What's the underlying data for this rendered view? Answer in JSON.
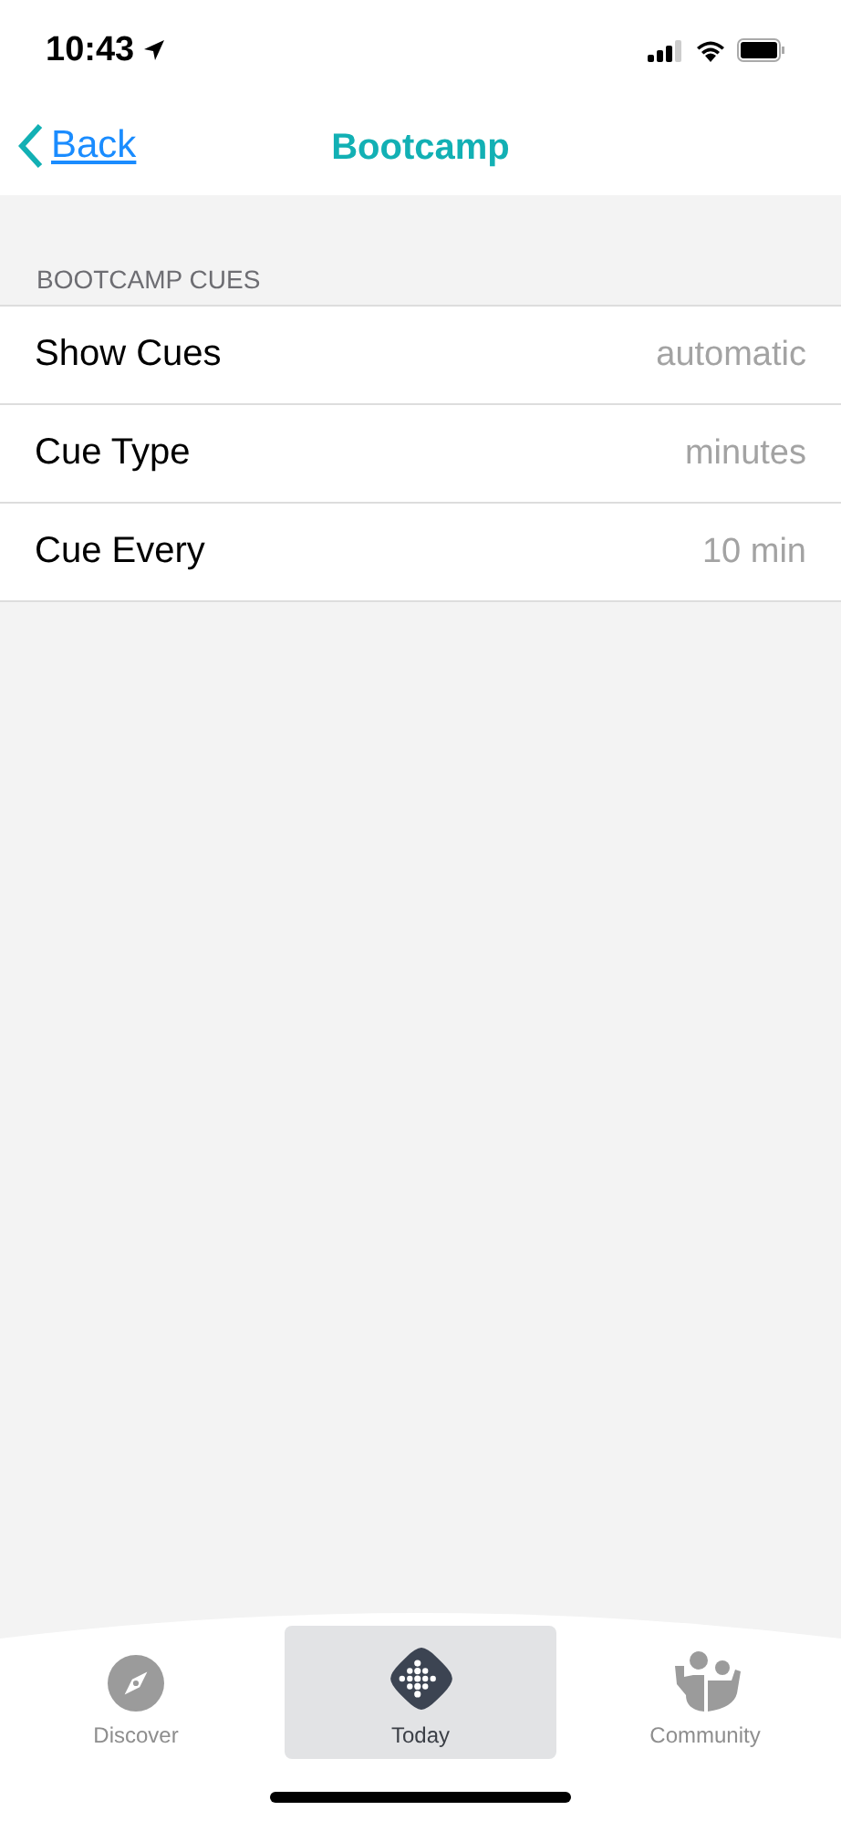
{
  "status_bar": {
    "time": "10:43"
  },
  "nav": {
    "back": "Back",
    "title": "Bootcamp"
  },
  "section": {
    "header": "BOOTCAMP CUES",
    "rows": [
      {
        "label": "Show Cues",
        "value": "automatic"
      },
      {
        "label": "Cue Type",
        "value": "minutes"
      },
      {
        "label": "Cue Every",
        "value": "10 min"
      }
    ]
  },
  "tabs": [
    {
      "label": "Discover",
      "kind": "compass",
      "selected": false
    },
    {
      "label": "Today",
      "kind": "dots",
      "selected": true
    },
    {
      "label": "Community",
      "kind": "people",
      "selected": false
    }
  ]
}
